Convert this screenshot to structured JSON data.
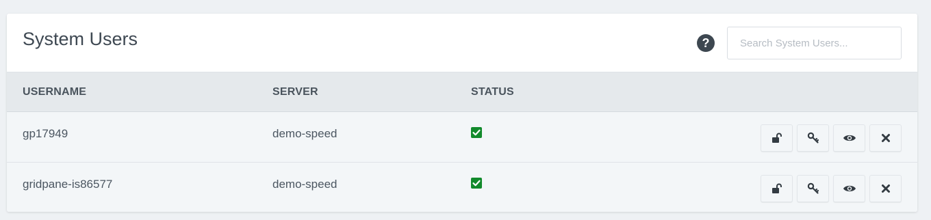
{
  "header": {
    "title": "System Users",
    "help_icon": "question-circle-icon",
    "help_glyph": "?",
    "search_placeholder": "Search System Users..."
  },
  "table": {
    "columns": [
      "USERNAME",
      "SERVER",
      "STATUS"
    ],
    "rows": [
      {
        "username": "gp17949",
        "server": "demo-speed",
        "status": "checked"
      },
      {
        "username": "gridpane-is86577",
        "server": "demo-speed",
        "status": "checked"
      }
    ],
    "row_actions": [
      "unlock-icon",
      "key-icon",
      "eye-icon",
      "close-icon"
    ]
  },
  "colors": {
    "status_green": "#128a2c",
    "icon_dark": "#3d4750"
  }
}
